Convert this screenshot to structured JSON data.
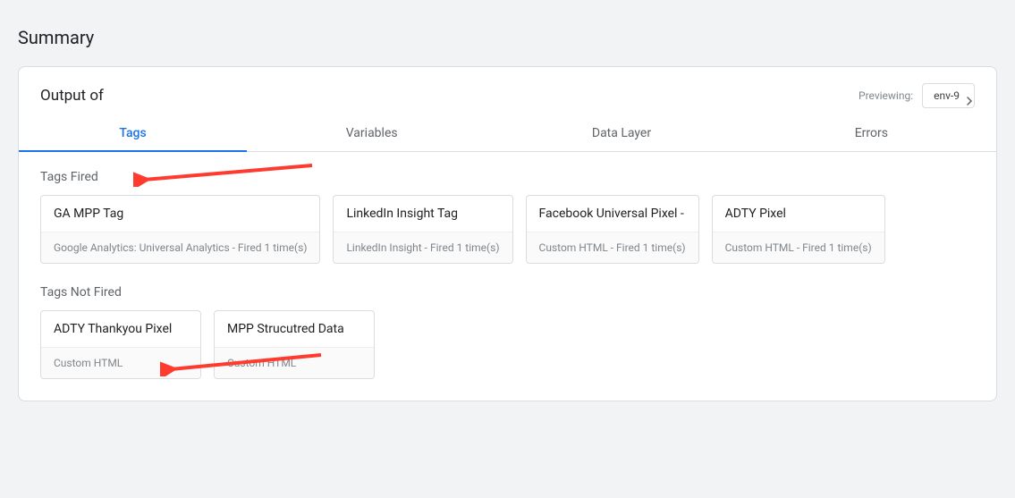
{
  "page_title": "Summary",
  "card_title": "Output of",
  "previewing_label": "Previewing:",
  "env_value": "env-9",
  "tabs": {
    "tags": "Tags",
    "variables": "Variables",
    "data_layer": "Data Layer",
    "errors": "Errors"
  },
  "sections": {
    "fired": {
      "title": "Tags Fired",
      "items": [
        {
          "name": "GA MPP Tag",
          "footer": "Google Analytics: Universal Analytics - Fired 1 time(s)"
        },
        {
          "name": "LinkedIn Insight Tag",
          "footer": "LinkedIn Insight - Fired 1 time(s)"
        },
        {
          "name": "Facebook Universal Pixel -",
          "footer": "Custom HTML - Fired 1 time(s)"
        },
        {
          "name": "ADTY Pixel",
          "footer": "Custom HTML - Fired 1 time(s)"
        }
      ]
    },
    "not_fired": {
      "title": "Tags Not Fired",
      "items": [
        {
          "name": "ADTY Thankyou Pixel",
          "footer": "Custom HTML"
        },
        {
          "name": "MPP Strucutred Data",
          "footer": "Custom HTML"
        }
      ]
    }
  }
}
